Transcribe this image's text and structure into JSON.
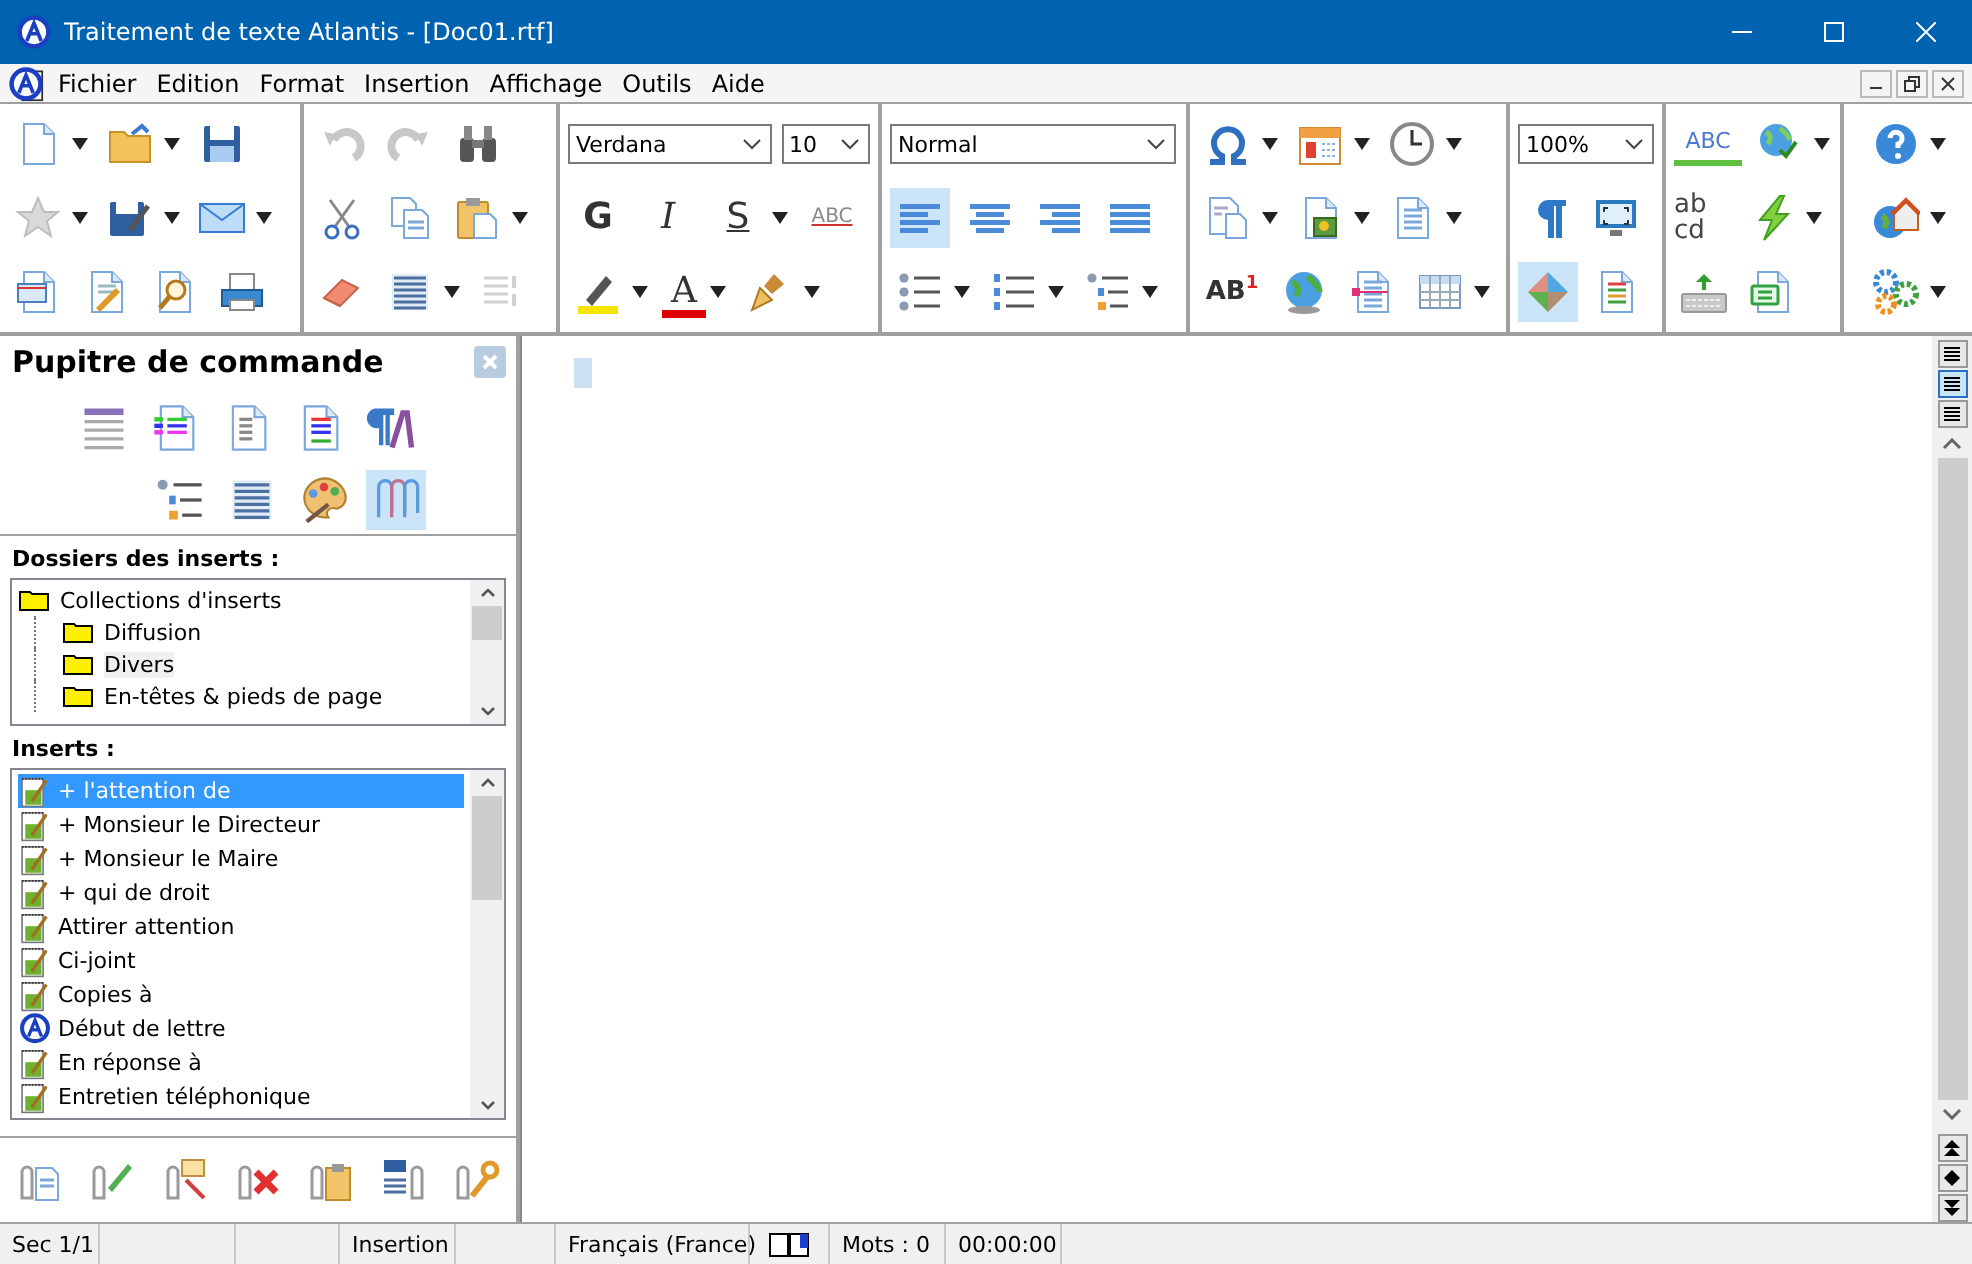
{
  "window": {
    "title": "Traitement de texte Atlantis - [Doc01.rtf]"
  },
  "menu": [
    "Fichier",
    "Edition",
    "Format",
    "Insertion",
    "Affichage",
    "Outils",
    "Aide"
  ],
  "toolbar": {
    "groups": [
      {
        "rows": [
          [
            {
              "kind": "icon",
              "dropdown": true
            },
            {
              "kind": "icon",
              "dropdown": true
            },
            {
              "kind": "icon",
              "dropdown": false
            }
          ],
          [
            {
              "kind": "icon",
              "dropdown": true
            },
            {
              "kind": "icon",
              "dropdown": true
            },
            {
              "kind": "icon",
              "dropdown": true
            }
          ],
          [
            {
              "kind": "icon",
              "dropdown": false
            },
            {
              "kind": "icon",
              "dropdown": false
            },
            {
              "kind": "icon",
              "dropdown": false
            },
            {
              "kind": "icon",
              "dropdown": false
            }
          ]
        ]
      },
      {
        "rows": [
          [
            {
              "kind": "icon",
              "dropdown": false
            },
            {
              "kind": "icon",
              "dropdown": false
            },
            {
              "kind": "icon",
              "dropdown": false
            }
          ],
          [
            {
              "kind": "icon",
              "dropdown": false
            },
            {
              "kind": "icon",
              "dropdown": false
            },
            {
              "kind": "icon",
              "dropdown": true
            }
          ],
          [
            {
              "kind": "icon",
              "dropdown": false
            },
            {
              "kind": "icon",
              "dropdown": true
            },
            {
              "kind": "icon",
              "dropdown": false
            }
          ]
        ]
      },
      {
        "rows": [
          [
            {
              "kind": "combo",
              "value": "Verdana"
            },
            {
              "kind": "combo",
              "value": "10"
            }
          ],
          [
            {
              "kind": "letter",
              "label": "G",
              "dropdown": false
            },
            {
              "kind": "letter",
              "label": "I",
              "dropdown": false
            },
            {
              "kind": "letter",
              "label": "S",
              "dropdown": true
            },
            {
              "kind": "letter",
              "label": "ABC",
              "dropdown": false
            }
          ],
          [
            {
              "kind": "icon",
              "dropdown": true
            },
            {
              "kind": "letter",
              "label": "A",
              "dropdown": true
            },
            {
              "kind": "icon",
              "dropdown": true
            }
          ]
        ]
      },
      {
        "rows": [
          [
            {
              "kind": "combo",
              "value": "Normal"
            }
          ],
          [
            {
              "kind": "icon",
              "dropdown": false,
              "selected": true
            },
            {
              "kind": "icon",
              "dropdown": false,
              "selected": false
            },
            {
              "kind": "icon",
              "dropdown": false,
              "selected": false
            },
            {
              "kind": "icon",
              "dropdown": false,
              "selected": false
            }
          ],
          [
            {
              "kind": "icon",
              "dropdown": true
            },
            {
              "kind": "icon",
              "dropdown": true
            },
            {
              "kind": "icon",
              "dropdown": true
            }
          ]
        ]
      },
      {
        "rows": [
          [
            {
              "kind": "icon",
              "dropdown": true
            },
            {
              "kind": "icon",
              "dropdown": true
            },
            {
              "kind": "icon",
              "dropdown": true
            }
          ],
          [
            {
              "kind": "icon",
              "dropdown": true
            },
            {
              "kind": "icon",
              "dropdown": true
            },
            {
              "kind": "icon",
              "dropdown": true
            }
          ],
          [
            {
              "kind": "letter",
              "label": "AB$^{1}$",
              "dropdown": false
            },
            {
              "kind": "icon",
              "dropdown": false
            },
            {
              "kind": "icon",
              "dropdown": false
            },
            {
              "kind": "icon",
              "dropdown": true
            }
          ]
        ]
      },
      {
        "rows": [
          [
            {
              "kind": "combo",
              "value": "100%"
            }
          ],
          [
            {
              "kind": "icon",
              "dropdown": false
            },
            {
              "kind": "icon",
              "dropdown": false
            }
          ],
          [
            {
              "kind": "icon",
              "dropdown": false,
              "selected": true
            },
            {
              "kind": "icon",
              "dropdown": false,
              "selected": false
            }
          ]
        ]
      },
      {
        "rows": [
          [
            {
              "kind": "letter",
              "label": "ABC",
              "dropdown": false
            },
            {
              "kind": "icon",
              "dropdown": true
            }
          ],
          [
            {
              "kind": "letter",
              "label": "ab cd",
              "dropdown": false
            },
            {
              "kind": "icon",
              "dropdown": true
            }
          ],
          [
            {
              "kind": "icon",
              "dropdown": false
            },
            {
              "kind": "icon",
              "dropdown": false
            }
          ]
        ]
      },
      {
        "rows": [
          [
            {
              "kind": "icon",
              "dropdown": true
            }
          ],
          [
            {
              "kind": "icon",
              "dropdown": true
            }
          ],
          [
            {
              "kind": "icon",
              "dropdown": true
            }
          ]
        ]
      }
    ]
  },
  "panel": {
    "title": "Pupitre de commande",
    "tools": [
      {
        "selected": false
      },
      {
        "selected": false
      },
      {
        "selected": false
      },
      {
        "selected": false
      },
      {
        "selected": false
      },
      {
        "selected": false
      },
      {
        "selected": false
      },
      {
        "selected": false
      },
      {
        "selected": true
      }
    ],
    "folders_label": "Dossiers des inserts :",
    "folders": [
      {
        "label": "Collections d'inserts",
        "selected": false,
        "children": [
          {
            "label": "Diffusion",
            "selected": false
          },
          {
            "label": "Divers",
            "selected": true
          },
          {
            "label": "En-têtes & pieds de page",
            "selected": false
          }
        ]
      }
    ],
    "inserts_label": "Inserts :",
    "inserts": [
      {
        "kind": "note",
        "label": "+ l'attention de",
        "selected": true
      },
      {
        "kind": "note",
        "label": "+ Monsieur le Directeur",
        "selected": false
      },
      {
        "kind": "note",
        "label": "+ Monsieur le Maire",
        "selected": false
      },
      {
        "kind": "note",
        "label": "+ qui de droit",
        "selected": false
      },
      {
        "kind": "note",
        "label": "Attirer attention",
        "selected": false
      },
      {
        "kind": "note",
        "label": "Ci-joint",
        "selected": false
      },
      {
        "kind": "note",
        "label": "Copies à",
        "selected": false
      },
      {
        "kind": "logo",
        "label": "Début de lettre",
        "selected": false
      },
      {
        "kind": "note",
        "label": "En réponse à",
        "selected": false
      },
      {
        "kind": "note",
        "label": "Entretien téléphonique",
        "selected": false
      }
    ]
  },
  "view_buttons": [
    {
      "selected": false
    },
    {
      "selected": true
    },
    {
      "selected": false
    }
  ],
  "status_bar": [
    "Sec 1/1",
    "Insertion",
    "Français (France)",
    "Mots : 0",
    "00:00:00"
  ]
}
